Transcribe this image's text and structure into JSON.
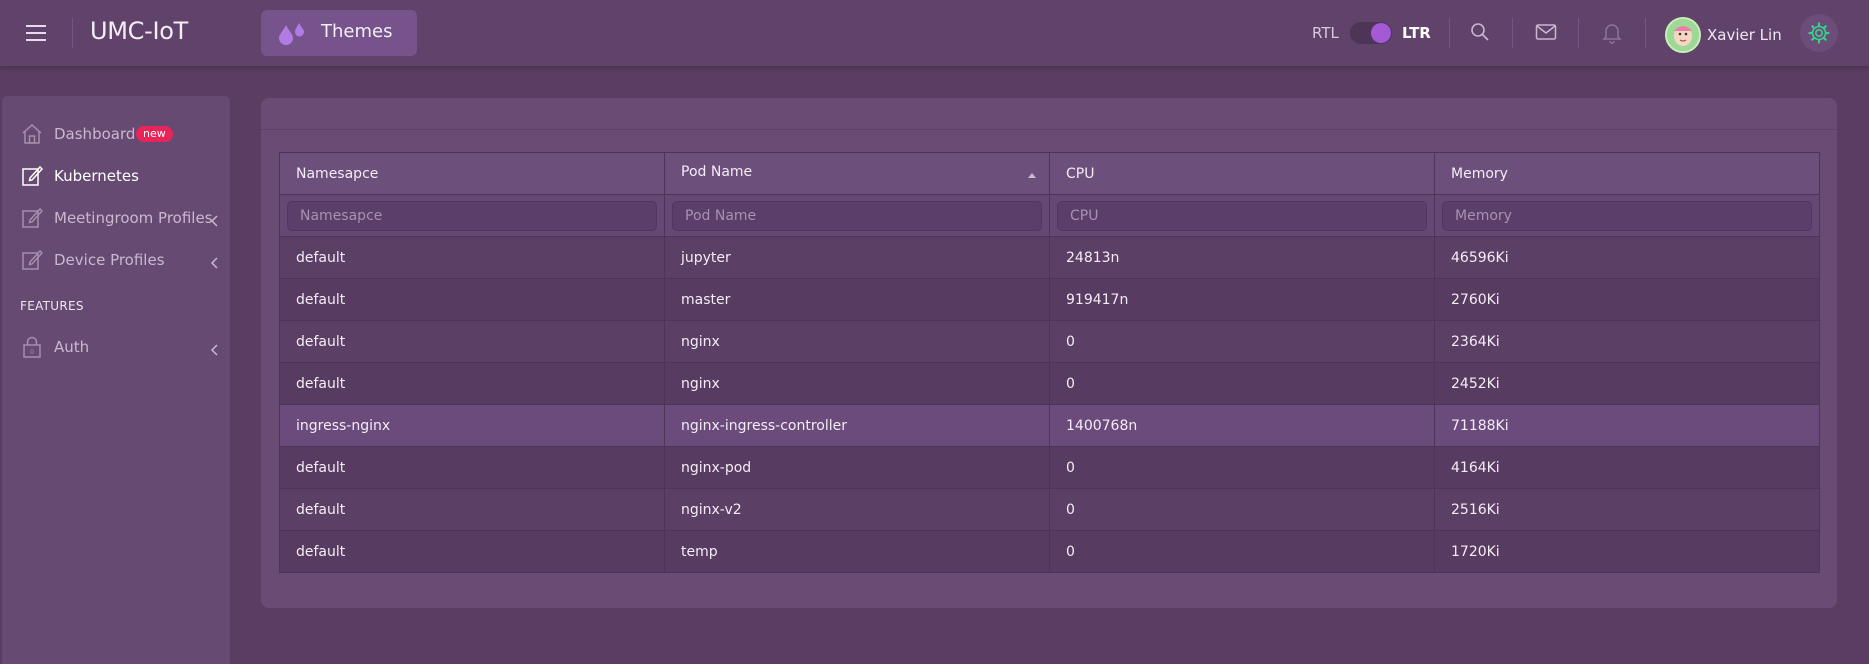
{
  "header": {
    "app_title": "UMC-IoT",
    "themes_label": "Themes",
    "rtl_label": "RTL",
    "ltr_label": "LTR",
    "direction": "LTR",
    "user_name": "Xavier Lin",
    "icons": [
      "hamburger-menu-icon",
      "drop-icon",
      "search-icon",
      "mail-icon",
      "bell-icon",
      "settings-icon"
    ]
  },
  "sidebar": {
    "items": [
      {
        "label": "Dashboard",
        "badge": "new",
        "icon": "home-icon",
        "active": false
      },
      {
        "label": "Kubernetes",
        "icon": "edit-icon",
        "active": true
      },
      {
        "label": "Meetingroom Profiles",
        "icon": "edit-icon",
        "active": false,
        "expandable": true
      },
      {
        "label": "Device Profiles",
        "icon": "edit-icon",
        "active": false,
        "expandable": true
      }
    ],
    "features_title": "FEATURES",
    "feature_items": [
      {
        "label": "Auth",
        "icon": "lock-icon",
        "expandable": true
      }
    ]
  },
  "table": {
    "columns": [
      "Namesapce",
      "Pod Name",
      "CPU",
      "Memory"
    ],
    "sorted_column": "Pod Name",
    "filters": [
      "Namesapce",
      "Pod Name",
      "CPU",
      "Memory"
    ],
    "rows": [
      [
        "default",
        "jupyter",
        "24813n",
        "46596Ki"
      ],
      [
        "default",
        "master",
        "919417n",
        "2760Ki"
      ],
      [
        "default",
        "nginx",
        "0",
        "2364Ki"
      ],
      [
        "default",
        "nginx",
        "0",
        "2452Ki"
      ],
      [
        "ingress-nginx",
        "nginx-ingress-controller",
        "1400768n",
        "71188Ki"
      ],
      [
        "default",
        "nginx-pod",
        "0",
        "4164Ki"
      ],
      [
        "default",
        "nginx-v2",
        "0",
        "2516Ki"
      ],
      [
        "default",
        "temp",
        "0",
        "1720Ki"
      ]
    ],
    "highlighted_row": 4
  },
  "colors": {
    "background": "#5a3d60",
    "header": "#61426a",
    "accent": "#a45ad6",
    "badge": "#e8245a"
  }
}
